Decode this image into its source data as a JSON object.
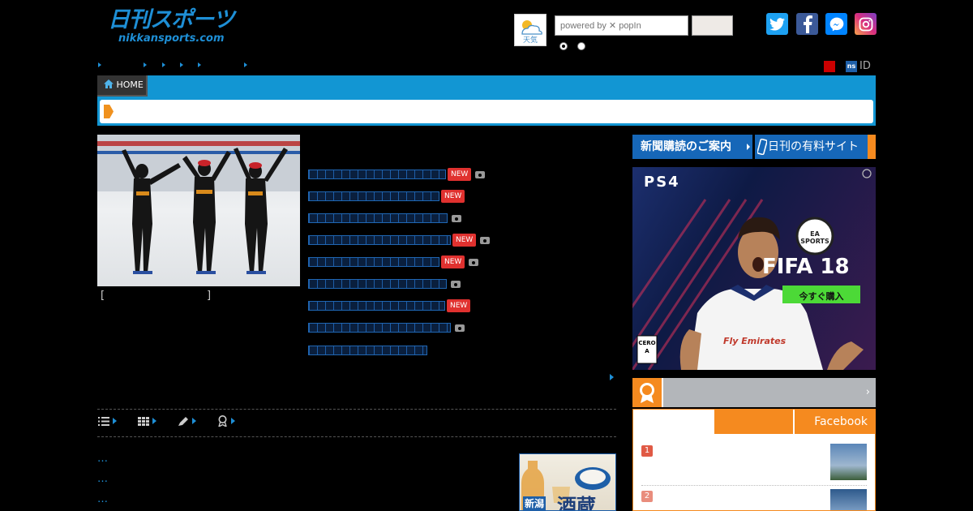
{
  "header": {
    "logo_jp": "日刊スポーツ",
    "logo_en": "nikkansports.com",
    "weather_label": "天気",
    "search_placeholder": "powered by ✕ popIn",
    "search_button": "",
    "id_label": "ID",
    "ns_badge": "ns"
  },
  "nav": {
    "home_label": "HOME"
  },
  "photo": {
    "caption_open": "[",
    "caption_close": "]"
  },
  "headlines": [
    {
      "new": true,
      "camera": true
    },
    {
      "new": true,
      "camera": false
    },
    {
      "new": false,
      "camera": true
    },
    {
      "new": true,
      "camera": true
    },
    {
      "new": true,
      "camera": true
    },
    {
      "new": false,
      "camera": true
    },
    {
      "new": true,
      "camera": false
    },
    {
      "new": false,
      "camera": true
    },
    {
      "new": false,
      "camera": false
    }
  ],
  "badges": {
    "new": "NEW"
  },
  "list_dots": [
    "…",
    "…",
    "…"
  ],
  "sidebar": {
    "subscribe_button": "新聞購読のご案内",
    "paid_button": "日刊の有料サイト",
    "ranking_tab_facebook": "Facebook",
    "ranking_numbers": [
      "1",
      "2"
    ]
  },
  "ad": {
    "platform": "PS4",
    "brand": "EA SPORTS",
    "game": "FIFA 18",
    "cta": "今すぐ購入",
    "sponsor": "Fly Emirates",
    "rating": "CERO A"
  },
  "sake_ad": {
    "text_1": "新潟",
    "text_2": "酒蔵"
  },
  "colors": {
    "brand_blue": "#1296d3",
    "accent_orange": "#f58a1f",
    "badge_red": "#e0312f",
    "link_blue": "#1e8fd6"
  }
}
